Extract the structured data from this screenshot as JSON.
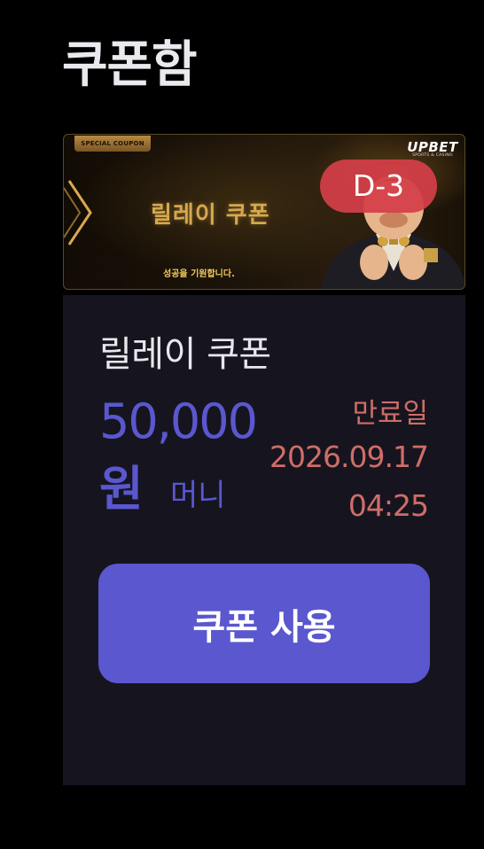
{
  "page": {
    "title": "쿠폰함"
  },
  "banner": {
    "tag": "SPECIAL COUPON",
    "title": "릴레이 쿠폰",
    "subtitle": "성공을 기원합니다.",
    "brand": "UPBET",
    "brand_sub": "SPORTS & CASINO",
    "dday": "D-3"
  },
  "coupon": {
    "name": "릴레이 쿠폰",
    "amount": "50,000",
    "unit": "원",
    "type": "머니",
    "expire_label": "만료일",
    "expire_date": "2026.09.17",
    "expire_time": "04:25",
    "use_button": "쿠폰 사용"
  },
  "colors": {
    "accent": "#5a57cf",
    "expire": "#cf6d68",
    "dday_bg": "#d43e48",
    "gold": "#d6a84e",
    "card_bg": "#16151f"
  }
}
